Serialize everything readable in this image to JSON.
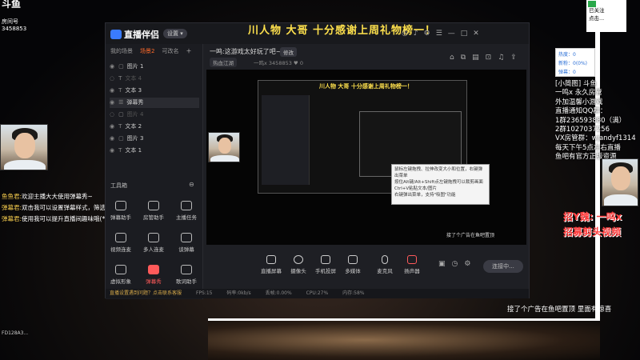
{
  "overlay": {
    "logo": "斗鱼",
    "room_label": "房间号",
    "room_number": "3458853",
    "bottom_id": "FD128A3..."
  },
  "chat": [
    {
      "name": "鱼鱼君:",
      "text": "欢迎主播大大使用弹幕秀~"
    },
    {
      "name": "弹幕君:",
      "text": "双击我可以设置弹幕样式，筛选展示哦~"
    },
    {
      "name": "弹幕君:",
      "text": "使用我可以提升直播间趣味哦(*^_^#)"
    }
  ],
  "app": {
    "brand": "直播伴侣",
    "pill": "设置 ▾",
    "banner": "川人物 大哥  十分感谢上周礼物榜一！",
    "titlebar_icons": [
      "◎",
      "♪",
      "⚙",
      "☰",
      "—",
      "□",
      "✕"
    ],
    "sidebar_tabs": [
      "我的场景",
      "场景2",
      "可改名"
    ],
    "sources": [
      {
        "label": "图片 1",
        "icon": "▢",
        "state": "normal"
      },
      {
        "label": "文本 4",
        "icon": "T",
        "state": "dim"
      },
      {
        "label": "文本 3",
        "icon": "T",
        "state": "normal"
      },
      {
        "label": "弹幕秀",
        "icon": "☰",
        "state": "normal"
      },
      {
        "label": "图片 4",
        "icon": "▢",
        "state": "dim"
      },
      {
        "label": "文本 2",
        "icon": "T",
        "state": "normal"
      },
      {
        "label": "图片 3",
        "icon": "▢",
        "state": "normal"
      },
      {
        "label": "文本 1",
        "icon": "T",
        "state": "normal"
      }
    ],
    "tools_header": "工具箱",
    "tools": [
      {
        "label": "弹幕助手",
        "hot": false
      },
      {
        "label": "房管助手",
        "hot": false
      },
      {
        "label": "主播任务",
        "hot": false
      },
      {
        "label": "视频连麦",
        "hot": false
      },
      {
        "label": "多人连麦",
        "hot": false
      },
      {
        "label": "谈弹幕",
        "hot": false
      },
      {
        "label": "虚拟形象",
        "hot": false
      },
      {
        "label": "弹幕秀",
        "hot": true
      },
      {
        "label": "歌词助手",
        "hot": false
      }
    ],
    "room_title": "一鸣:这游戏太好玩了吧~~",
    "edit_label": "修改",
    "category": "热血江湖",
    "stats_text": "一鸣x  3458853  ♥ 0",
    "right_icons": [
      "⌂",
      "⧉",
      "▤",
      "⊡",
      "♫",
      "⇪"
    ],
    "tooltip_lines": [
      "鼠标左键拖拽、拉伸改变大小和位置，右键弹出菜单",
      "按住Alt键/Alt+Shift点左键拖拽可以裁剪画面",
      "Ctrl+V粘贴文本/图片",
      "右键弹出菜单，支持\"吸图\"功能"
    ],
    "ad_line": "接了个广告在鱼吧置顶",
    "controls": [
      "直播屏幕",
      "摄像头",
      "手机投屏",
      "多媒体",
      "麦克风",
      "扬声器"
    ],
    "go_live": "连接中...",
    "status": {
      "warning": "直播设置遇到问题？点击联系客服",
      "fps": "FPS:15",
      "bitrate": "码率:0kb/s",
      "dropped": "丢帧:0.00%",
      "cpu": "CPU:27%",
      "memory": "内存:58%"
    }
  },
  "right_panel": {
    "white_box": [
      "已关注",
      "点击..."
    ],
    "info": [
      "热度：0",
      "新粉：0(0%)",
      "弹幕：0"
    ],
    "lines": [
      "[小简图]  斗鱼",
      "一鸣x 永久房管",
      "外加温馨小游戏",
      "直播通知QQ群：",
      "1群236593880（满）",
      "2群1027037256",
      "VX房管群：wjandyf1314",
      "每天下午5点左右直播",
      "鱼吧有官方正版资源"
    ],
    "promo1": "招Y魏: 一鸣x",
    "promo2": "招募剪头视频",
    "ad_big": "接了个广告在鱼吧置顶 里面有惊喜"
  }
}
